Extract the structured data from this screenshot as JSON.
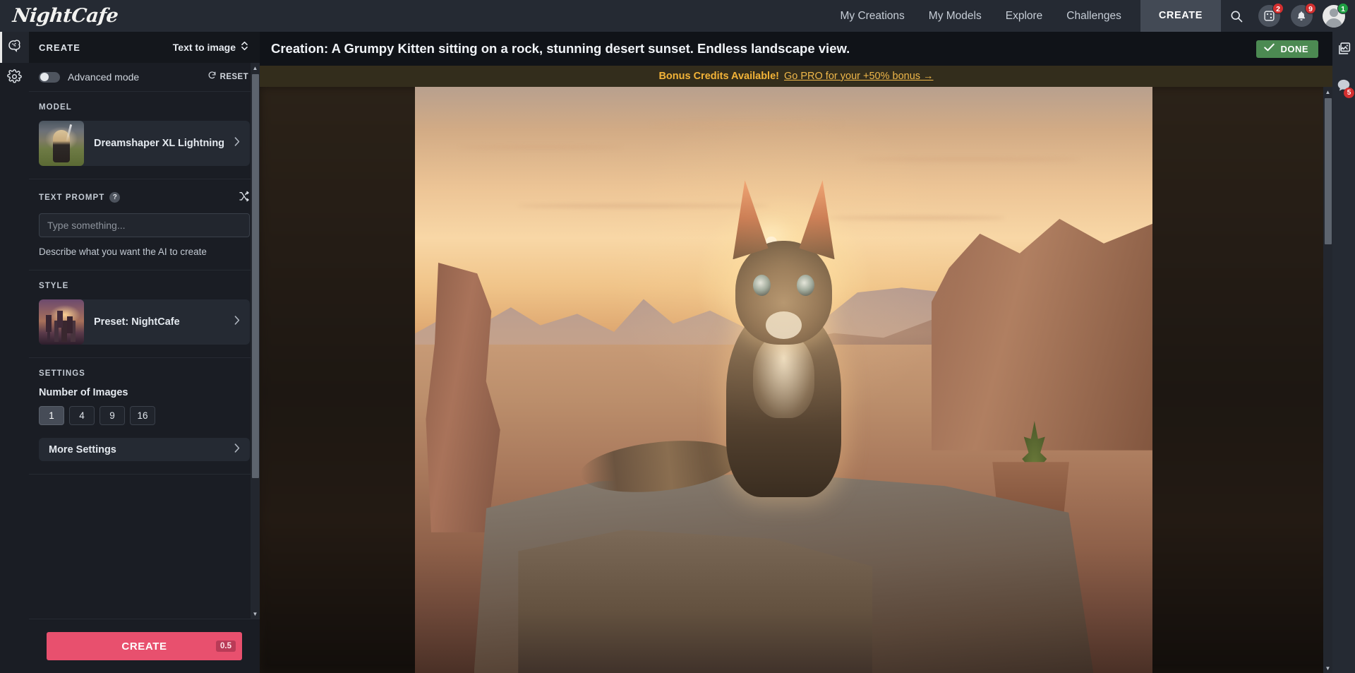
{
  "navbar": {
    "brand": "NightCafe",
    "links": [
      {
        "label": "My Creations"
      },
      {
        "label": "My Models"
      },
      {
        "label": "Explore"
      },
      {
        "label": "Challenges"
      }
    ],
    "create_label": "CREATE",
    "icons": {
      "search": "search-icon",
      "dice": "dice-icon",
      "bell": "bell-icon",
      "avatar": "avatar-icon"
    },
    "badges": {
      "dice": "2",
      "bell": "9",
      "avatar": "1"
    }
  },
  "left_rail": {
    "items": [
      {
        "name": "brain-icon",
        "active": true
      },
      {
        "name": "gear-icon",
        "active": false
      }
    ]
  },
  "sidebar": {
    "header": {
      "title": "CREATE",
      "mode": "Text to image"
    },
    "advanced": {
      "label": "Advanced mode",
      "reset_label": "RESET",
      "enabled": false
    },
    "model": {
      "section_label": "MODEL",
      "name": "Dreamshaper XL Lightning"
    },
    "prompt": {
      "section_label": "TEXT PROMPT",
      "help": "?",
      "value": "",
      "placeholder": "Type something...",
      "hint": "Describe what you want the AI to create"
    },
    "style": {
      "section_label": "STYLE",
      "name": "Preset: NightCafe"
    },
    "settings": {
      "section_label": "SETTINGS",
      "number_of_images_label": "Number of Images",
      "options": [
        "1",
        "4",
        "9",
        "16"
      ],
      "selected": "1",
      "more_settings_label": "More Settings"
    },
    "footer": {
      "create_label": "CREATE",
      "credits": "0.5"
    }
  },
  "main": {
    "title": "Creation: A Grumpy Kitten sitting on a rock, stunning desert sunset. Endless landscape view.",
    "done_label": "DONE",
    "banner": {
      "bold": "Bonus Credits Available!",
      "link": "Go PRO for your +50% bonus →"
    },
    "artwork": {
      "description": "A grumpy tabby kitten sitting on a rock slab at desert sunset with endless mesa landscape"
    }
  },
  "right_rail": {
    "items": [
      {
        "name": "gallery-icon",
        "badge": ""
      },
      {
        "name": "chat-icon",
        "badge": "5"
      }
    ]
  },
  "colors": {
    "accent_pink": "#e8506e",
    "done_green": "#4c8a52",
    "banner_gold": "#f2b338",
    "badge_red": "#d32f2f",
    "badge_green": "#1e9e42"
  }
}
